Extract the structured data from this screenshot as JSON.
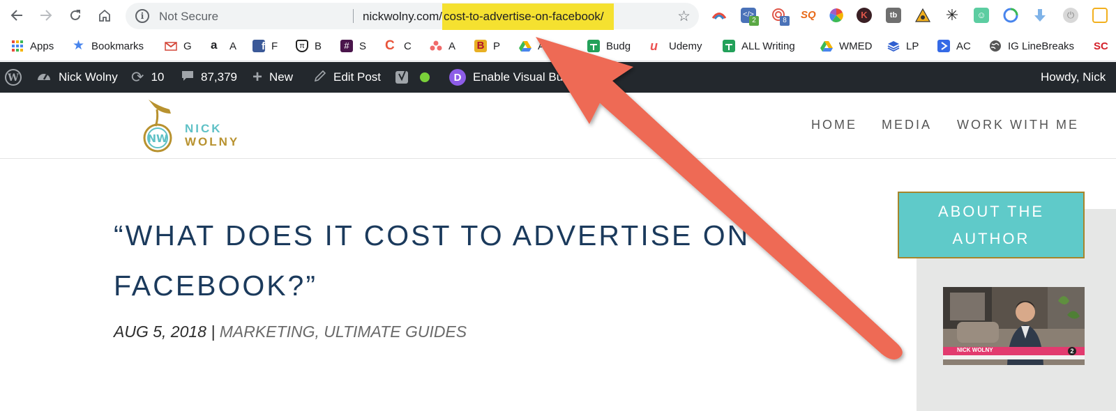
{
  "browser": {
    "security_label": "Not Secure",
    "info_glyph": "i",
    "url_host": "nickwolny.com/",
    "url_path": "cost-to-advertise-on-facebook/",
    "badges": {
      "ext2": "2",
      "ext3": "8"
    }
  },
  "bookmarks": [
    {
      "label": "Apps",
      "icon": "apps-grid-icon"
    },
    {
      "label": "Bookmarks",
      "icon": "star-icon"
    },
    {
      "label": "G",
      "icon": "gmail-icon"
    },
    {
      "label": "A",
      "icon": "amazon-icon"
    },
    {
      "label": "F",
      "icon": "facebook-icon"
    },
    {
      "label": "B",
      "icon": "pi-icon"
    },
    {
      "label": "S",
      "icon": "slack-icon"
    },
    {
      "label": "C",
      "icon": "c-icon"
    },
    {
      "label": "A",
      "icon": "asana-icon"
    },
    {
      "label": "P",
      "icon": "b-logo-icon"
    },
    {
      "label": "AD",
      "icon": "drive-icon"
    },
    {
      "label": "Budg",
      "icon": "sheets-icon"
    },
    {
      "label": "Udemy",
      "icon": "udemy-icon"
    },
    {
      "label": "ALL Writing",
      "icon": "sheets-icon"
    },
    {
      "label": "WMED",
      "icon": "drive-icon"
    },
    {
      "label": "LP",
      "icon": "layers-icon"
    },
    {
      "label": "AC",
      "icon": "ac-icon"
    },
    {
      "label": "IG LineBreaks",
      "icon": "globe-icon"
    },
    {
      "label": "SC",
      "icon": "sc-icon"
    }
  ],
  "wp_admin": {
    "site_name": "Nick Wolny",
    "updates_count": "10",
    "comments_count": "87,379",
    "new_label": "New",
    "edit_post_label": "Edit Post",
    "divi_badge": "D",
    "visual_builder_label": "Enable Visual Builder",
    "greeting": "Howdy, Nick"
  },
  "site": {
    "logo_line1": "NICK",
    "logo_line2": "WOLNY",
    "logo_monogram": "NW",
    "nav": [
      "HOME",
      "MEDIA",
      "WORK WITH ME"
    ]
  },
  "post": {
    "title_line1": "“WHAT DOES IT COST TO ADVERTISE ON",
    "title_line2": "FACEBOOK?”",
    "date": "AUG 5, 2018",
    "separator": " | ",
    "categories": "MARKETING, ULTIMATE GUIDES"
  },
  "sidebar": {
    "about_line1": "ABOUT THE",
    "about_line2": "AUTHOR",
    "photo_caption": "NICK WOLNY",
    "photo_channel": "2"
  },
  "colors": {
    "url_highlight": "#f5e130",
    "wp_bar": "#23282d",
    "title_navy": "#1b3a5c",
    "teal": "#5fcac9",
    "gold": "#a6852a",
    "arrow": "#ee6a55"
  }
}
